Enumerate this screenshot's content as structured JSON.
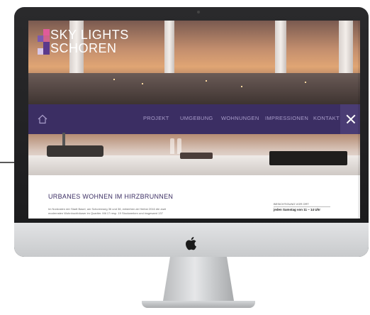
{
  "site": {
    "logo_line1": "SKY LIGHTS",
    "logo_line2": "SCHOREN"
  },
  "nav": {
    "items": [
      "PROJEKT",
      "UMGEBUNG",
      "WOHNUNGEN",
      "IMPRESSIONEN",
      "KONTAKT"
    ],
    "home_icon": "home-icon",
    "close_icon": "close-icon"
  },
  "content": {
    "heading": "URBANES WOHNEN IM HIRZBRUNNEN",
    "body_line1": "Im Nordosten der Stadt Basel, am Schorenweg 36 und 38, entstehen ab Herbst 2016 die zwei",
    "body_line2": "modernsten Wohnhochhäuser im Quartier. Mit 17 resp. 19 Stockwerken und insgesamt 137"
  },
  "info": {
    "label": "BESICHTIGUNG VOR ORT",
    "value": "jeden Samstag von 11 – 14 Uhr"
  },
  "colors": {
    "nav_bg": "#3b2e63",
    "nav_text": "#a89cc9",
    "logo_pink": "#e05a9a",
    "logo_purple": "#5b3a8c"
  }
}
